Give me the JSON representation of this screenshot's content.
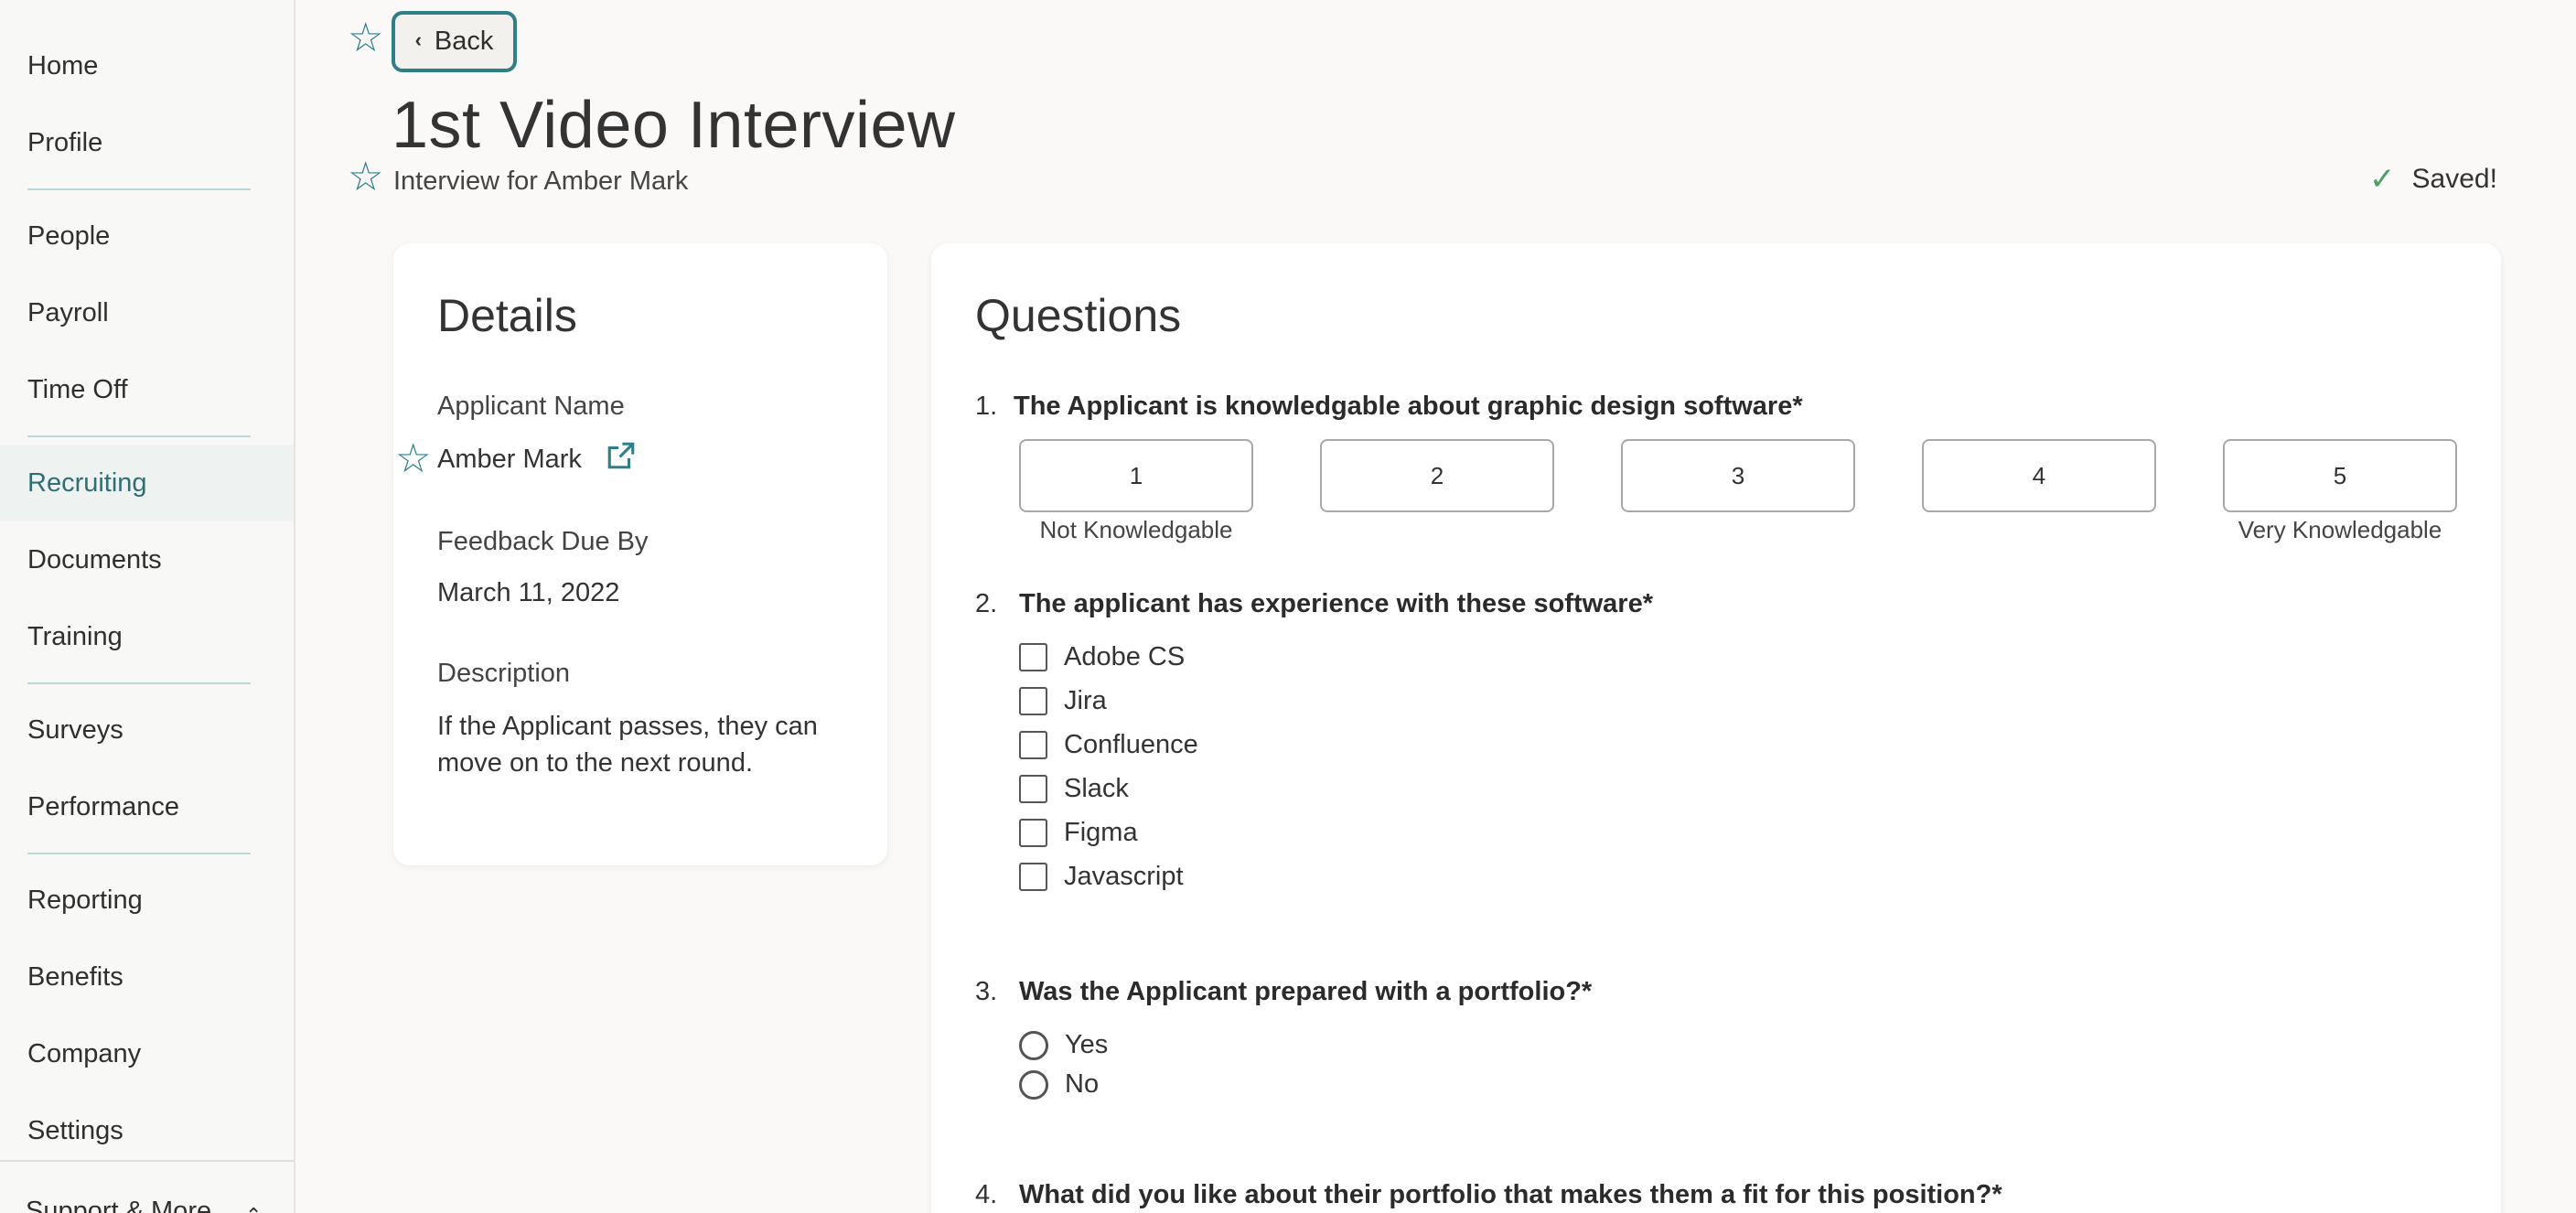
{
  "sidebar": {
    "items": [
      {
        "label": "Home"
      },
      {
        "label": "Profile"
      },
      {
        "label": "People"
      },
      {
        "label": "Payroll"
      },
      {
        "label": "Time Off"
      },
      {
        "label": "Recruiting"
      },
      {
        "label": "Documents"
      },
      {
        "label": "Training"
      },
      {
        "label": "Surveys"
      },
      {
        "label": "Performance"
      },
      {
        "label": "Reporting"
      },
      {
        "label": "Benefits"
      },
      {
        "label": "Company"
      },
      {
        "label": "Settings"
      }
    ],
    "active_item": "Recruiting",
    "support_label": "Support & More"
  },
  "header": {
    "back_label": "Back",
    "title": "1st Video Interview",
    "subtitle": "Interview for Amber Mark",
    "saved_label": "Saved!"
  },
  "details": {
    "title": "Details",
    "applicant_label": "Applicant Name",
    "applicant_name": "Amber Mark",
    "due_label": "Feedback Due By",
    "due_value": "March 11, 2022",
    "description_label": "Description",
    "description_value": "If the Applicant passes, they can move on to the next round."
  },
  "questions": {
    "title": "Questions",
    "q1": {
      "number": "1.",
      "text": "The Applicant is knowledgable about graphic design software*",
      "scale": [
        "1",
        "2",
        "3",
        "4",
        "5"
      ],
      "min_caption": "Not Knowledgable",
      "max_caption": "Very Knowledgable"
    },
    "q2": {
      "number": "2.",
      "text": "The applicant has experience with these software*",
      "options": [
        "Adobe CS",
        "Jira",
        "Confluence",
        "Slack",
        "Figma",
        "Javascript"
      ]
    },
    "q3": {
      "number": "3.",
      "text": "Was the Applicant prepared with a portfolio?*",
      "options": [
        "Yes",
        "No"
      ]
    },
    "q4": {
      "number": "4.",
      "text": "What did you like about their portfolio that makes them a fit for this position?*"
    }
  },
  "colors": {
    "accent": "#2f7f86",
    "active_nav_bg": "#eef3f2",
    "active_nav_text": "#2f6f73",
    "saved_check": "#4aa06b",
    "page_bg": "#faf9f7"
  },
  "icons": {
    "back": "chevron-left-icon",
    "star": "star-outline-icon",
    "external": "external-link-icon",
    "saved": "check-icon",
    "support": "chevron-up-icon"
  }
}
